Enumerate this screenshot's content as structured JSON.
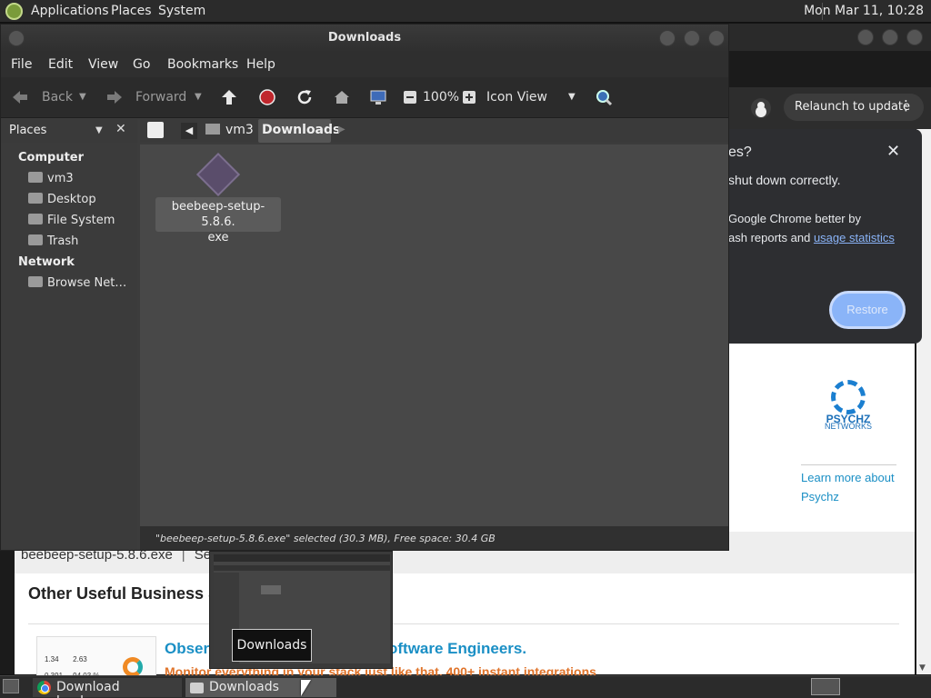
{
  "top_panel": {
    "menus": [
      "Applications",
      "Places",
      "System"
    ],
    "clock": "Mon Mar 11, 10:28"
  },
  "chrome": {
    "relaunch_label": "Relaunch to update",
    "popup": {
      "title_fragment": "es?",
      "text1": "shut down correctly.",
      "text2": "Google Chrome better by",
      "text3_prefix": "ash reports and ",
      "text3_link": "usage statistics",
      "restore_label": "Restore"
    },
    "page": {
      "filename_line": "beebeep-setup-5.8.6.exe",
      "filename_sep": "|",
      "filename_after": "Se",
      "other_heading": "Other Useful Business So",
      "observ_left": "Observ",
      "observ_right": "oftware Engineers.",
      "monitor_text": "Monitor everything in your stack just like that. 400+ instant integrations",
      "thumb_values": [
        "1.34",
        "2.63",
        "0.391",
        "94.03 %"
      ]
    },
    "ad": {
      "brand": "PSYCHZ",
      "sub": "NETWORKS",
      "learn_more": "Learn more about Psychz"
    }
  },
  "file_manager": {
    "title": "Downloads",
    "menu": [
      "File",
      "Edit",
      "View",
      "Go",
      "Bookmarks",
      "Help"
    ],
    "toolbar": {
      "back": "Back",
      "forward": "Forward",
      "zoom": "100%",
      "view_mode": "Icon View"
    },
    "sidebar": {
      "header": "Places",
      "sections": [
        {
          "title": "Computer",
          "items": [
            "vm3",
            "Desktop",
            "File System",
            "Trash"
          ]
        },
        {
          "title": "Network",
          "items": [
            "Browse Net…"
          ]
        }
      ]
    },
    "path": [
      "vm3",
      "Downloads"
    ],
    "files": [
      {
        "name": "beebeep-setup-5.8.6.exe",
        "label_line1": "beebeep-setup-5.8.6.",
        "label_line2": "exe"
      }
    ],
    "status": "\"beebeep-setup-5.8.6.exe\" selected (30.3 MB), Free space: 30.4 GB"
  },
  "taskbar": {
    "tasks": [
      "Download beebeep...",
      "Downloads"
    ],
    "tooltip": "Downloads"
  }
}
